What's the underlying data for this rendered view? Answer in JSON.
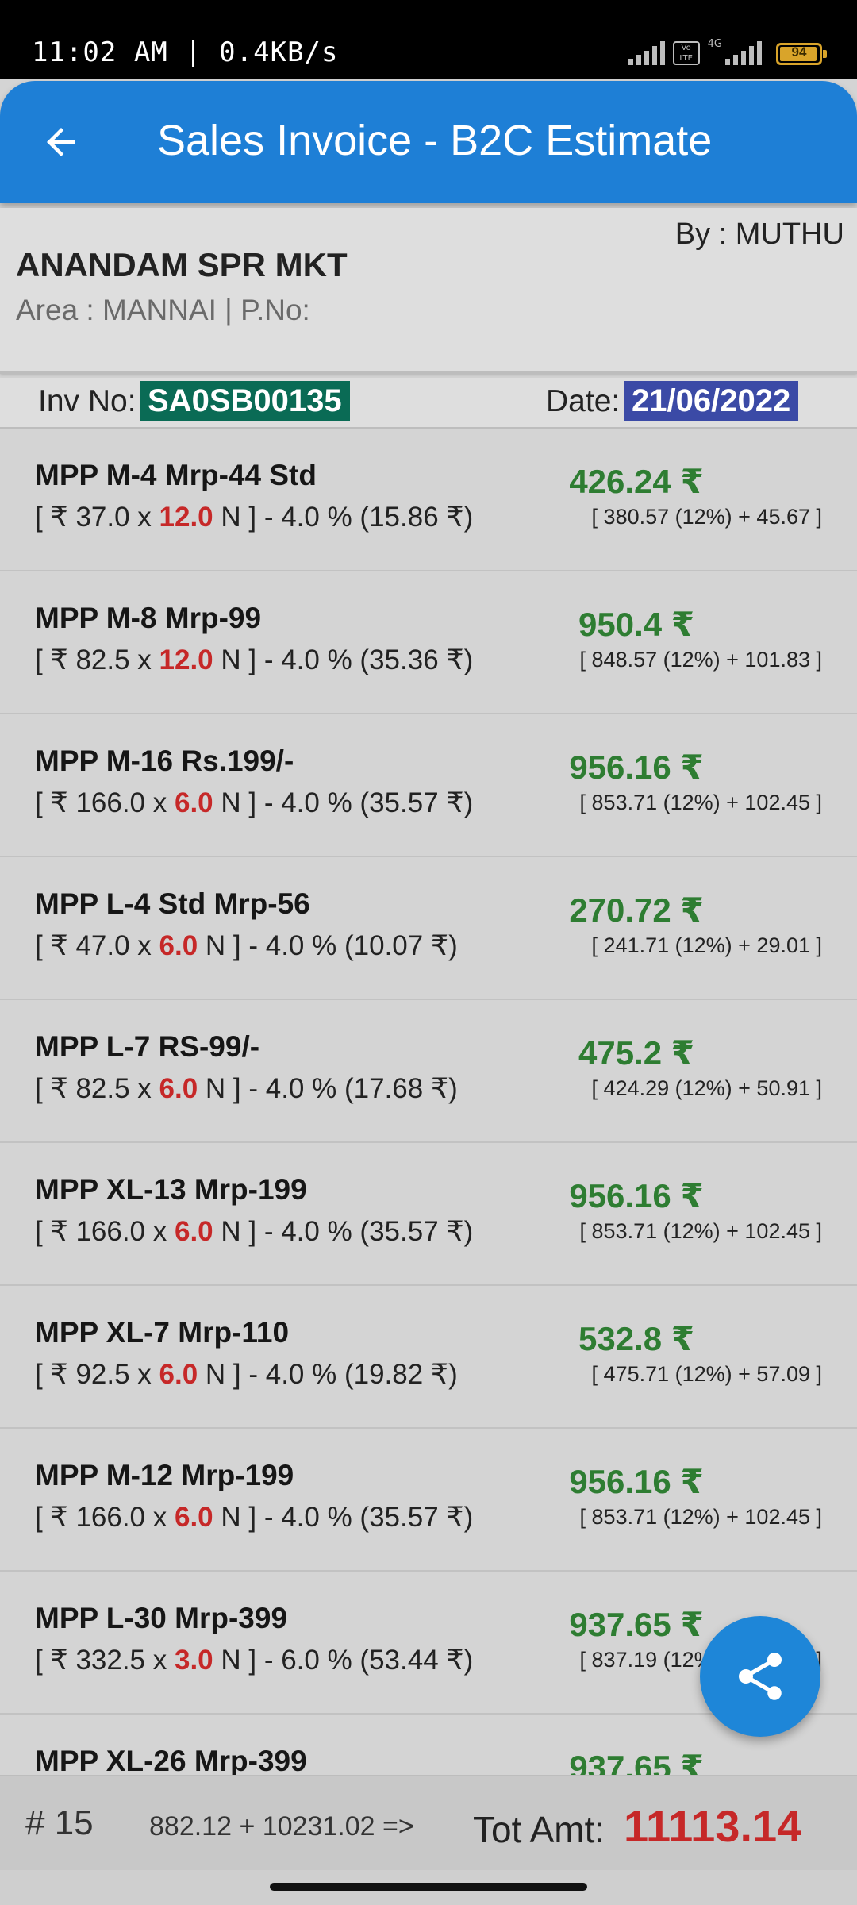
{
  "status_bar": {
    "left_text": "11:02 AM | 0.4KB/s",
    "volte": "Vo LTE",
    "network": "4G",
    "battery": "94"
  },
  "app_bar": {
    "title": "Sales Invoice - B2C Estimate",
    "back_icon": "arrow-left-icon"
  },
  "customer": {
    "by": "By : MUTHU",
    "name": "ANANDAM SPR MKT",
    "area": "Area : MANNAI | P.No:"
  },
  "invoice": {
    "inv_label": "Inv No:",
    "inv_no": "SA0SB00135",
    "date_label": "Date:",
    "date": "21/06/2022"
  },
  "items": [
    {
      "name": "MPP M-4 Mrp-44 Std",
      "pre": "[ ₹ 37.0 x ",
      "qty": "12.0",
      "post": " N ] - 4.0 % (15.86 ₹)",
      "amount": "426.24 ₹",
      "tax": "[ 380.57 (12%) + 45.67 ]"
    },
    {
      "name": "MPP M-8 Mrp-99",
      "pre": "[ ₹ 82.5 x ",
      "qty": "12.0",
      "post": " N ] - 4.0 % (35.36 ₹)",
      "amount": "950.4 ₹",
      "tax": "[ 848.57 (12%) + 101.83 ]"
    },
    {
      "name": "MPP M-16 Rs.199/-",
      "pre": "[ ₹ 166.0 x ",
      "qty": "6.0",
      "post": " N ] - 4.0 % (35.57 ₹)",
      "amount": "956.16 ₹",
      "tax": "[ 853.71 (12%) + 102.45 ]"
    },
    {
      "name": "MPP L-4 Std Mrp-56",
      "pre": "[ ₹ 47.0 x ",
      "qty": "6.0",
      "post": " N ] - 4.0 % (10.07 ₹)",
      "amount": "270.72 ₹",
      "tax": "[ 241.71 (12%) + 29.01 ]"
    },
    {
      "name": "MPP L-7 RS-99/-",
      "pre": "[ ₹ 82.5 x ",
      "qty": "6.0",
      "post": " N ] - 4.0 % (17.68 ₹)",
      "amount": "475.2 ₹",
      "tax": "[ 424.29 (12%) + 50.91 ]"
    },
    {
      "name": "MPP XL-13 Mrp-199",
      "pre": "[ ₹ 166.0 x ",
      "qty": "6.0",
      "post": " N ] - 4.0 % (35.57 ₹)",
      "amount": "956.16 ₹",
      "tax": "[ 853.71 (12%) + 102.45 ]"
    },
    {
      "name": "MPP XL-7 Mrp-110",
      "pre": "[ ₹ 92.5 x ",
      "qty": "6.0",
      "post": " N ] - 4.0 % (19.82 ₹)",
      "amount": "532.8 ₹",
      "tax": "[ 475.71 (12%) + 57.09 ]"
    },
    {
      "name": "MPP M-12 Mrp-199",
      "pre": "[ ₹ 166.0 x ",
      "qty": "6.0",
      "post": " N ] - 4.0 % (35.57 ₹)",
      "amount": "956.16 ₹",
      "tax": "[ 853.71 (12%) + 102.45 ]"
    },
    {
      "name": "MPP L-30 Mrp-399",
      "pre": "[ ₹ 332.5 x ",
      "qty": "3.0",
      "post": " N ] - 6.0 % (53.44 ₹)",
      "amount": "937.65 ₹",
      "tax": "[ 837.19 (12%) + 100.46 ]"
    },
    {
      "name": "MPP XL-26 Mrp-399",
      "pre": "",
      "qty": "",
      "post": "",
      "amount": "937.65 ₹",
      "tax": ""
    }
  ],
  "fab": {
    "icon": "share-icon"
  },
  "footer": {
    "count": "# 15",
    "sum_expr": "882.12 + 10231.02 =>",
    "tot_label": "Tot Amt:",
    "tot_value": "11113.14"
  },
  "colors": {
    "app_bar": "#1e7fd6",
    "inv_no_bg": "#0a6b55",
    "date_bg": "#3b4aa6",
    "amount": "#2e7d32",
    "qty": "#c62828",
    "total": "#c62828"
  }
}
